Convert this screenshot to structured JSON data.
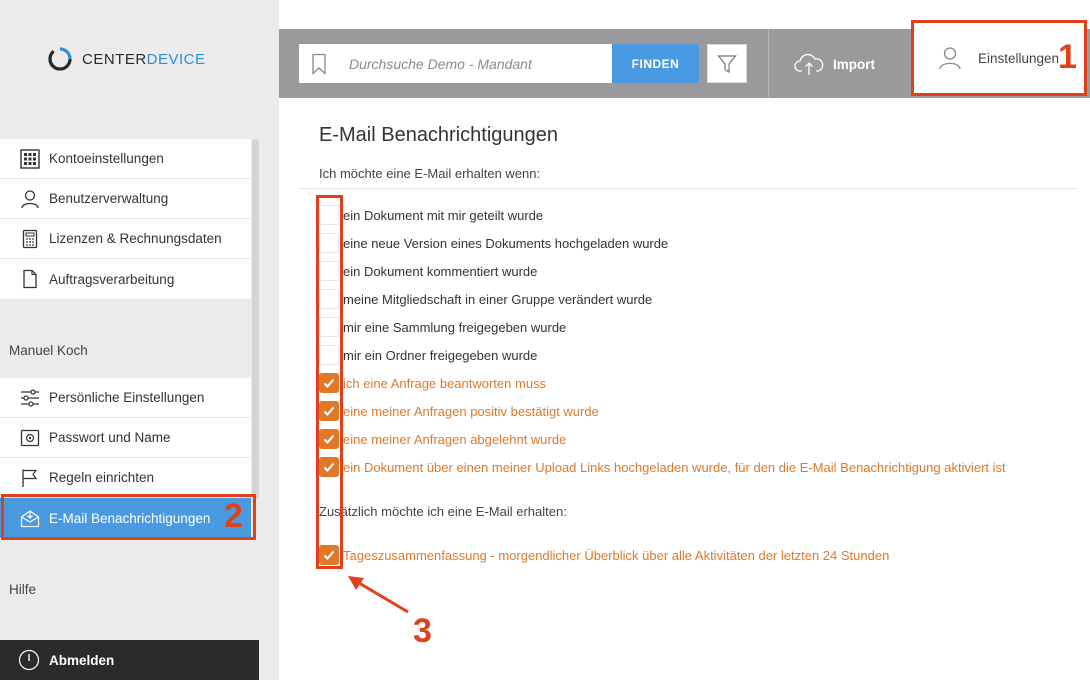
{
  "logo": {
    "text_main": "CENTER",
    "text_accent": "DEVICE",
    "accent_color": "#2f8fd3"
  },
  "sidebar": {
    "group1": [
      {
        "label": "Kontoeinstellungen",
        "icon": "grid-icon"
      },
      {
        "label": "Benutzerverwaltung",
        "icon": "user-icon"
      },
      {
        "label": "Lizenzen & Rechnungsdaten",
        "icon": "calculator-icon"
      },
      {
        "label": "Auftragsverarbeitung",
        "icon": "document-icon"
      }
    ],
    "user_heading": "Manuel Koch",
    "group2": [
      {
        "label": "Persönliche Einstellungen",
        "icon": "sliders-icon"
      },
      {
        "label": "Passwort und Name",
        "icon": "id-card-icon"
      },
      {
        "label": "Regeln einrichten",
        "icon": "flag-icon"
      },
      {
        "label": "E-Mail Benachrichtigungen",
        "icon": "mail-icon",
        "active": true
      }
    ],
    "help_heading": "Hilfe",
    "logout_label": "Abmelden",
    "active_color": "#4a9ae1"
  },
  "topbar": {
    "search_placeholder": "Durchsuche Demo - Mandant",
    "search_button": "FINDEN",
    "import_label": "Import",
    "settings_label": "Einstellungen"
  },
  "main": {
    "title": "E-Mail Benachrichtigungen",
    "subtitle": "Ich möchte eine E-Mail erhalten wenn:",
    "options": [
      {
        "label": "ein Dokument mit mir geteilt wurde",
        "checked": false
      },
      {
        "label": "eine neue Version eines Dokuments hochgeladen wurde",
        "checked": false
      },
      {
        "label": "ein Dokument kommentiert wurde",
        "checked": false
      },
      {
        "label": "meine Mitgliedschaft in einer Gruppe verändert wurde",
        "checked": false
      },
      {
        "label": "mir eine Sammlung freigegeben wurde",
        "checked": false
      },
      {
        "label": "mir ein Ordner freigegeben wurde",
        "checked": false
      },
      {
        "label": "ich eine Anfrage beantworten muss",
        "checked": true
      },
      {
        "label": "eine meiner Anfragen positiv bestätigt wurde",
        "checked": true
      },
      {
        "label": "eine meiner Anfragen abgelehnt wurde",
        "checked": true
      },
      {
        "label": "ein Dokument über einen meiner Upload Links hochgeladen wurde, für den die E-Mail Benachrichtigung aktiviert ist",
        "checked": true
      }
    ],
    "extra_heading": "Zusätzlich möchte ich eine E-Mail erhalten:",
    "extra_options": [
      {
        "label": "Tageszusammenfassung - morgendlicher Überblick über alle Aktivitäten der letzten 24 Stunden",
        "checked": true
      }
    ],
    "checked_color": "#e0782a"
  },
  "annotations": {
    "n1": "1",
    "n2": "2",
    "n3": "3",
    "color": "#e0411b"
  }
}
